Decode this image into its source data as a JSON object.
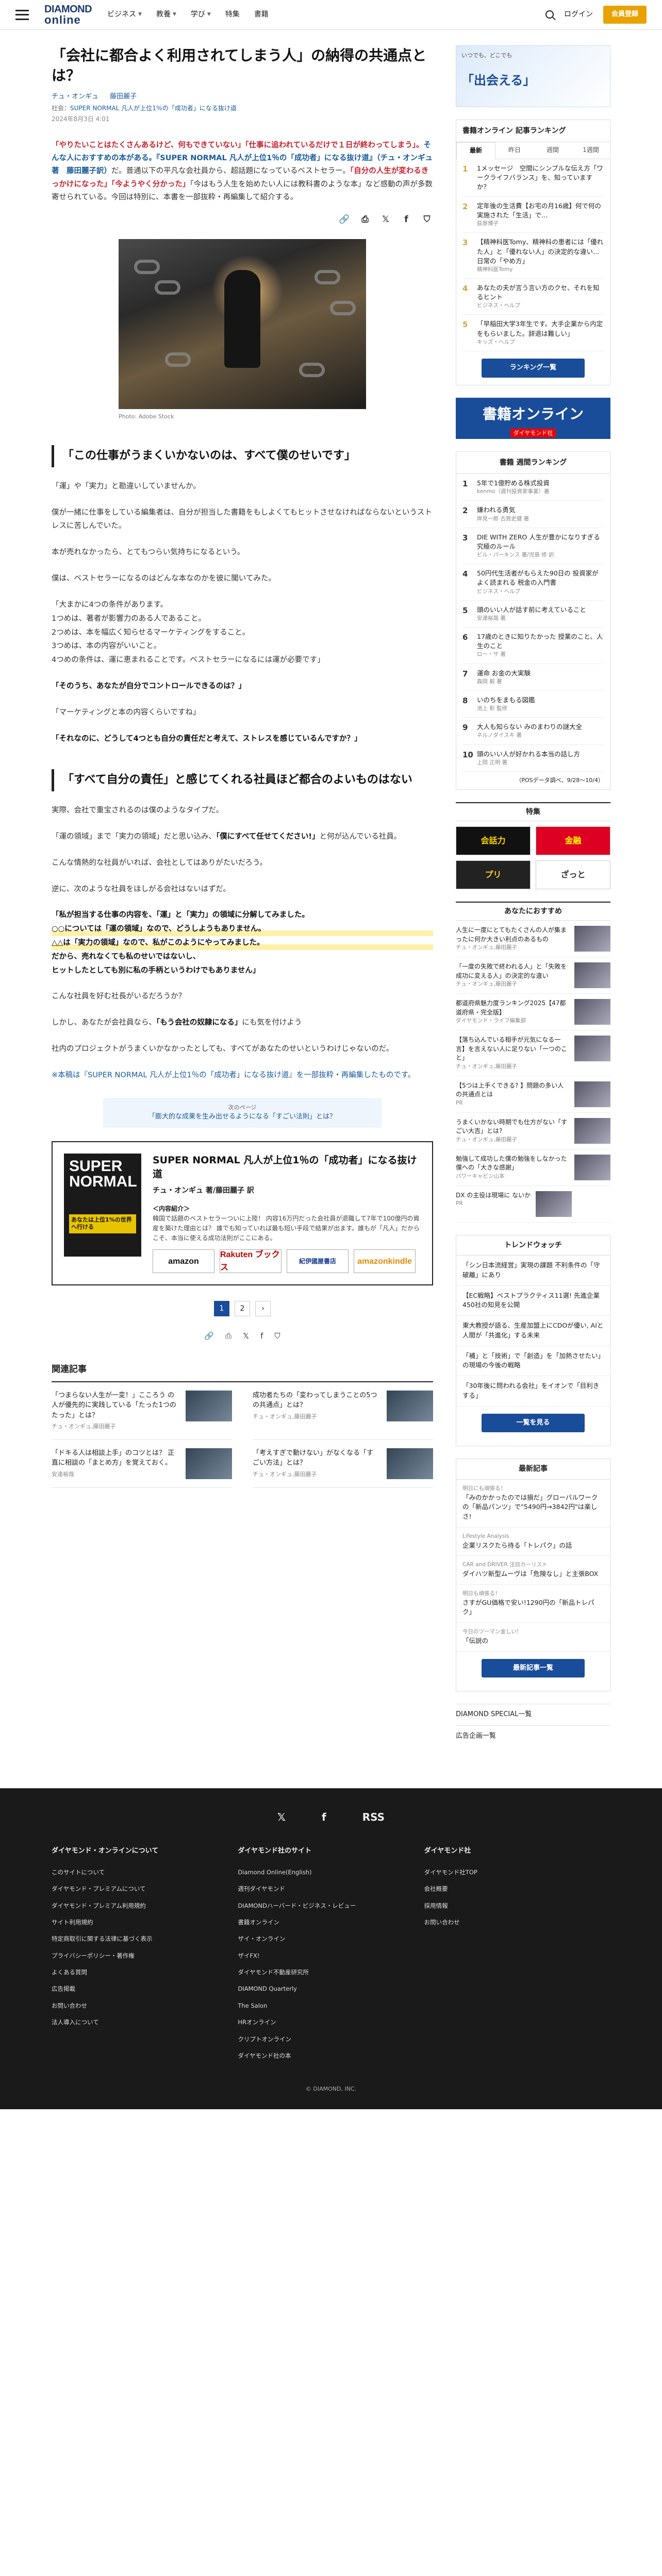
{
  "header": {
    "logo_top": "DIAMOND",
    "logo_bottom": "online",
    "nav": [
      {
        "label": "ビジネス"
      },
      {
        "label": "教養"
      },
      {
        "label": "学び"
      },
      {
        "label": "特集"
      },
      {
        "label": "書籍"
      }
    ],
    "login": "ログイン",
    "member": "会員登録"
  },
  "article": {
    "title": "「会社に都合よく利用されてしまう人」の納得の共通点とは？",
    "authors": [
      "チュ・オンギュ",
      "藤田麗子"
    ],
    "series_prefix": "社会：",
    "series_link": "SUPER NORMAL 凡人が上位1％の「成功者」になる抜け道",
    "date": "2024年8月3日 4:01",
    "lead_1": "「やりたいことはたくさんあるけど、何もできていない」「仕事に追われているだけで１日が終わってしまう」。",
    "lead_2": "そんな人におすすめの本がある。",
    "lead_3": "『SUPER NORMAL 凡人が上位1％の「成功者」になる抜け道』（チュ・オンギュ著　藤田麗子訳）",
    "lead_4": "だ。普通以下の平凡な会社員から、超話題になっているベストセラー。",
    "lead_5": "「自分の人生が変わるきっかけになった」「今ようやく分かった」",
    "lead_6": "「今はもう人生を始めたい人には教科書のような本」など感動の声が多数寄せられている。今回は特別に、本書を一部抜粋・再編集して紹介する。",
    "caption": "Photo: Adobe Stock",
    "h2_1": "「この仕事がうまくいかないのは、すべて僕のせいです」",
    "paras_1": [
      "「運」や「実力」と勘違いしていませんか。",
      "僕が一緒に仕事をしている編集者は、自分が担当した書籍をもしよくてもヒットさせなければならないというストレスに苦しんでいた。",
      "本が売れなかったら、とてもつらい気持ちになるという。",
      "僕は、ベストセラーになるのはどんな本なのかを彼に聞いてみた。"
    ],
    "paras_2": [
      "「大まかに4つの条件があります。",
      "1つめは、著者が影響力のある人であること。",
      "2つめは、本を幅広く知らせるマーケティングをすること。",
      "3つめは、本の内容がいいこと。",
      "4つめの条件は、運に恵まれることです。ベストセラーになるには運が必要です」"
    ],
    "bold_1": "「そのうち、あなたが自分でコントロールできるのは？」",
    "para_3": "「マーケティングと本の内容くらいですね」",
    "bold_2": "「それなのに、どうして4つとも自分の責任だと考えて、ストレスを感じているんですか？」",
    "h2_2": "「すべて自分の責任」と感じてくれる社員ほど都合のよいものはない",
    "paras_4": [
      "実際、会社で重宝されるのは僕のようなタイプだ。",
      "「運の領域」まで「実力の領域」だと思い込み、",
      "こんな情熱的な社員がいれば、会社としてはありがたいだろう。",
      "逆に、次のような社員をほしがる会社はないはずだ。"
    ],
    "em_1": "「僕にすべて任せてください!」",
    "em_1_tail": "と何が込んでいる社員。",
    "quote": [
      "「私が担当する仕事の内容を、「運」と「実力」の領域に分解してみました。",
      "○○については「運の領域」なので、どうしようもありません。",
      "△△は「実力の領域」なので、私がこのようにやってみました。",
      "だから、売れなくても私のせいではないし、",
      "ヒットしたとしても別に私の手柄というわけでもありません」"
    ],
    "paras_5": [
      "こんな社員を好む社長がいるだろうか？",
      "しかし、あなたが会社員なら、",
      "社内のプロジェクトがうまくいかなかったとしても、すべてがあなたのせいというわけじゃないのだ。"
    ],
    "b_self": "「もう会社の奴隷になる」",
    "b_self_tail": "にも気を付けよう",
    "note": "※本稿は『SUPER NORMAL 凡人が上位1％の「成功者」になる抜け道』を一部抜粋・再編集したものです。",
    "next_small": "次のページ",
    "next_label": "「膨大的な成果を生み出せるようになる「すごい法則」とは？",
    "book": {
      "cover_title": "SUPER NORMAL",
      "cover_band": "あなたは上位1%の世界へ行ける",
      "title": "SUPER NORMAL 凡人が上位1％の「成功者」になる抜け道",
      "author": "チュ・オンギュ 著/藤田麗子 訳",
      "desc_label": "＜内容紹介＞",
      "desc": "韓国で話題のベストセラーついに上陸！ 内容16万円だった会社員が退職して7年で100億円の資産を築けた理由とは？ 誰でも知っていれば最も短い手段で結果が出ます。誰もが「凡人」だからこそ、本当に使える成功法則がここにある。",
      "stores": [
        "amazon",
        "Rakuten ブックス",
        "紀伊國屋書店",
        "amazonkindle"
      ]
    },
    "pages": [
      "1",
      "2",
      "›"
    ],
    "related_title": "関連記事",
    "related": [
      {
        "title": "「つまらない人生が一変！」こころう の人が優先的に実践している「たった1つのたった」とは？",
        "by": "チュ・オンギュ,藤田麗子"
      },
      {
        "title": "成功者たちの「変わってしまうことの5つの共通点」とは？",
        "by": "チュ・オンギュ,藤田麗子"
      },
      {
        "title": "「ドキる人は相談上手」のコツとは？ 正直に相談の「まとめ方」を覚えておく。",
        "by": "安達裕哉"
      },
      {
        "title": "「考えすぎで動けない」がなくなる「すごい方法」とは？",
        "by": "チュ・オンギュ,藤田麗子"
      }
    ]
  },
  "sidebar": {
    "ad_big": "「出会える」",
    "ad_sm": "いつでも、どこでも",
    "ranking_title": "書籍オンライン 記事ランキング",
    "ranking_tabs": [
      "最新",
      "昨日",
      "週間",
      "1週間"
    ],
    "ranking": [
      {
        "t": "1メッセージ　空間にシンプルな伝え方「ワークライフバランス」を、知っていますか？",
        "a": ""
      },
      {
        "t": "定年後の生活費【お宅の月16歳】何で何の実施された「生活」で…",
        "a": "荻原博子"
      },
      {
        "t": "【精神科医Tomy、精神科の患者には「優れた人」と「優れない人」の決定的な違い…日常の「やめ方」",
        "a": "精神科医Tomy"
      },
      {
        "t": "あなたの夫が言う言い方のクセ、それを知るヒント",
        "a": "ビジネス・ヘルプ"
      },
      {
        "t": "「早稲田大学3年生です。大手企業から内定をもらいました。辞退は難しい」",
        "a": "キッズ・ヘルプ"
      }
    ],
    "ranking_more": "ランキング一覧",
    "banner_top": "書籍オンライン",
    "banner_bot": "ダイヤモンド社",
    "bookrank_title": "書籍 週間ランキング",
    "bookrank": [
      {
        "t": "5年で1億貯める株式投資",
        "a": "kenmo（週刊投資家事業）著"
      },
      {
        "t": "嫌われる勇気",
        "a": "岸見一郎 古賀史健 著"
      },
      {
        "t": "DIE WITH ZERO 人生が豊かになりすぎる究極のルール",
        "a": "ビル・パーキンス 著/児島 修 訳"
      },
      {
        "t": "50円代生活者がもらえた90日の 投資家がよく読まれる 税金の入門書",
        "a": "ビジネス・ヘルプ"
      },
      {
        "t": "頭のいい人が話す前に考えていること",
        "a": "安達裕哉 著"
      },
      {
        "t": "17歳のときに知りたかった 授業のこと、人生のこと",
        "a": "ロー・サ 著"
      },
      {
        "t": "運命 お金の大実験",
        "a": "森岡 毅 著"
      },
      {
        "t": "いのちをまもる図鑑",
        "a": "池上 彰 監修"
      },
      {
        "t": "大人も知らない みのまわりの謎大全",
        "a": "ネルノダイスキ 著"
      },
      {
        "t": "頭のいい人が好かれる本当の話し方",
        "a": "上岡 正明 著"
      }
    ],
    "bookrank_note": "（POSデータ調べ、9/28〜10/4）",
    "feature_title": "特集",
    "features": [
      "会話力",
      "金融",
      "プリ",
      "ざっと"
    ],
    "rec_title": "あなたにおすすめ",
    "rec": [
      {
        "t": "人生に一度にとてもたくさんの人が集まったに何か大きい利点のあるもの",
        "a": "チュ・オンギュ,藤田麗子"
      },
      {
        "t": "「一度の失敗で終われる人」と「失敗を成功に変える人」の決定的な違い",
        "a": "チュ・オンギュ,藤田麗子"
      },
      {
        "t": "都道府県魅力度ランキング2025【47都道府県・完全版】",
        "a": "ダイヤモンド・ライフ編集部"
      },
      {
        "t": "【落ち込んでいる相手が元気になる一言】を言えない人に足りない「一つのこと」",
        "a": "チュ・オンギュ,藤田麗子"
      },
      {
        "t": "【5つは上手くできる? 】問題の多い人の共通点とは",
        "a": "PR"
      },
      {
        "t": "うまくいかない時期でも仕方がない「すごい大吉」とは?",
        "a": "チュ・オンギュ,藤田麗子"
      },
      {
        "t": "勉強して成功した僕の勉強をしなかった僕への「大きな感謝」",
        "a": "パワーキャビン山本"
      },
      {
        "t": "DX の主役は現場に ないか",
        "a": "PR"
      }
    ],
    "trend_title": "トレンドウォッチ",
    "trend": [
      "「シン日本流経営」実現の課題 不利条件の「守破離」にあり",
      "【EC戦略】ベストプラクティス11選! 先進企業450社の知見を公開",
      "東大教授が語る、生産加盟上にCDOが優い, AIと人間が「共進化」する未来",
      "「補」と「技術」で「創造」を「加熱させたい」の現場の今後の戦略",
      "「30年後に問われる会社」をイオンで「目利きする」"
    ],
    "trend_more": "一覧を見る",
    "latest_title": "最新記事",
    "latest": [
      {
        "s": "明日にも頑張る！",
        "t": "「みのかかったのでは損だ」グローバルワークの「新品パンツ」で\"5490円→3842円\"は楽しさ!"
      },
      {
        "s": "Lifestyle Analysis",
        "t": "企業リスクたら待る「トレパク」の話"
      },
      {
        "s": "CAR and DRIVER 注目カーリスト",
        "t": "ダイハツ新型ムーヴは「危険なし」と主張BOX"
      },
      {
        "s": "明日も頑張る！",
        "t": "さすがGU価格で安い!1290円の「新品トレパク」"
      },
      {
        "s": "今日のツーマン金しい!",
        "t": "「伝説の"
      }
    ],
    "latest_more": "最新記事一覧",
    "links": [
      "DIAMOND SPECIAL一覧",
      "広告企画一覧"
    ]
  },
  "footer": {
    "social": [
      "𝕏",
      "f",
      "RSS"
    ],
    "cols": [
      {
        "h": "ダイヤモンド・オンラインについて",
        "items": [
          "このサイトについて",
          "ダイヤモンド・プレミアムについて",
          "ダイヤモンド・プレミアム利用規約",
          "サイト利用規約",
          "特定商取引に関する法律に基づく表示",
          "プライバシーポリシー・著作権",
          "よくある質問",
          "広告掲載",
          "お問い合わせ",
          "法人導入について"
        ]
      },
      {
        "h": "ダイヤモンド社のサイト",
        "items": [
          "Diamond Online(English)",
          "週刊ダイヤモンド",
          "DIAMONDハーバード・ビジネス・レビュー",
          "書籍オンライン",
          "ザイ・オンライン",
          "ザイFX!",
          "ダイヤモンド不動産研究所",
          "DIAMOND Quarterly",
          "The Salon",
          "HRオンライン",
          "クリプトオンライン",
          "ダイヤモンド社の本"
        ]
      },
      {
        "h": "ダイヤモンド社",
        "items": [
          "ダイヤモンド社TOP",
          "会社概要",
          "採用情報",
          "お問い合わせ"
        ]
      }
    ],
    "copy": "© DIAMOND, INC."
  }
}
